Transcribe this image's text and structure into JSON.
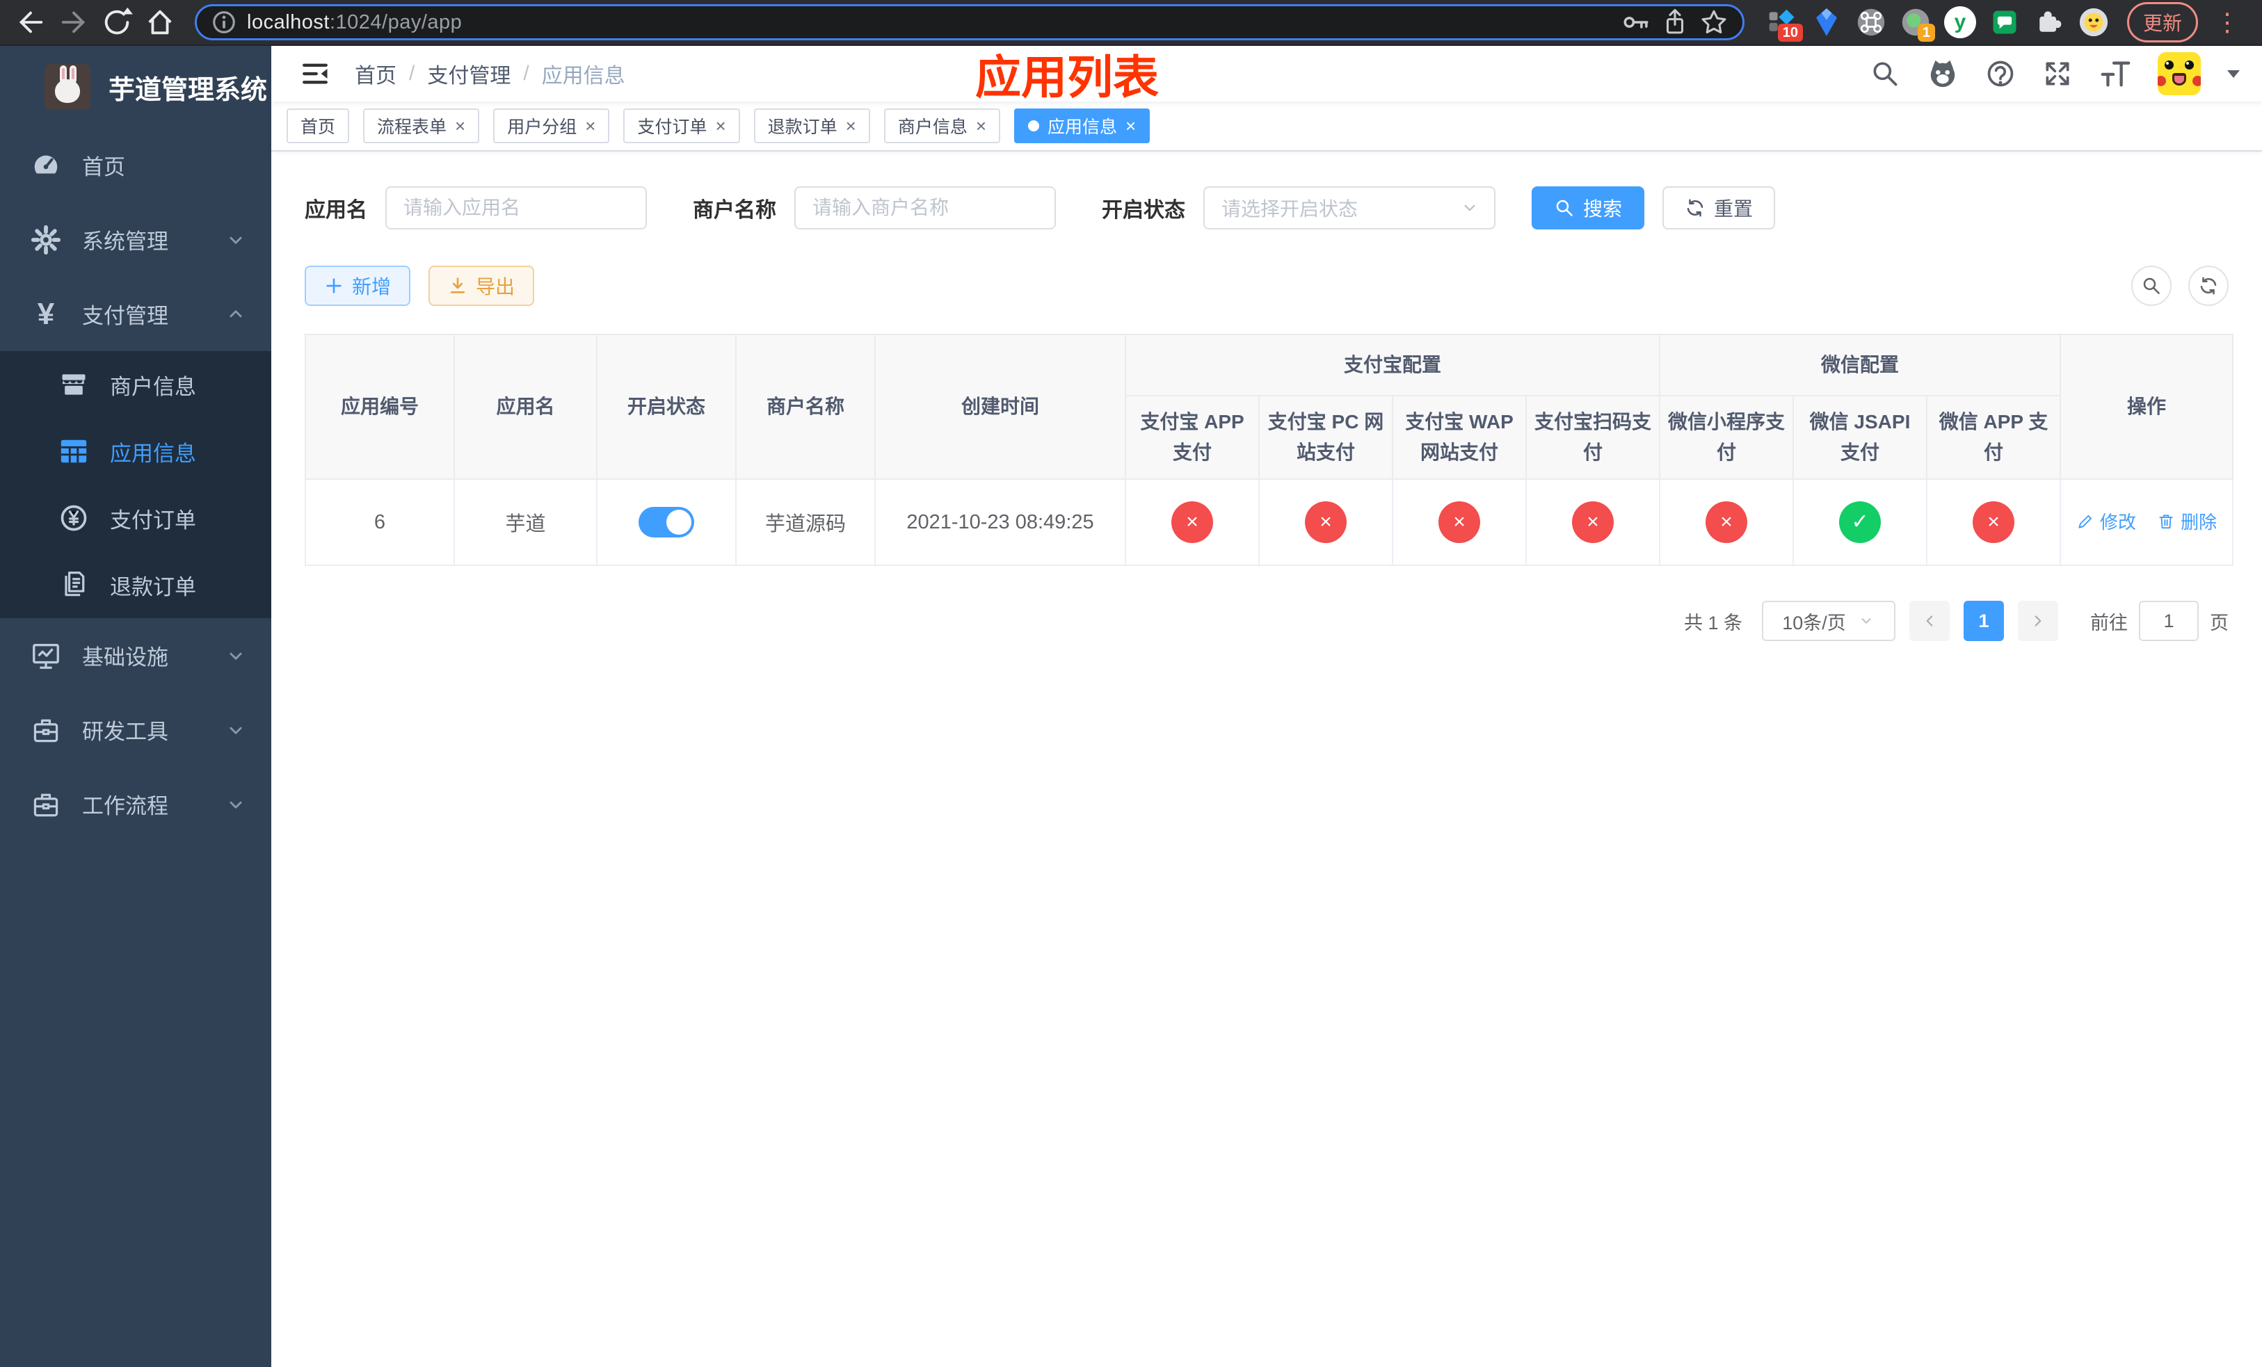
{
  "colors": {
    "primary": "#409eff",
    "danger": "#f34d4d",
    "success": "#13ce66",
    "warning": "#e6a23c",
    "annotation_red": "#ff3300",
    "sidebar_bg": "#304156",
    "submenu_bg": "#1f2d3d"
  },
  "browser": {
    "url_host": "localhost",
    "url_rest": ":1024/pay/app",
    "update_label": "更新",
    "ext_badge_pin": "10",
    "ext_badge_one": "1",
    "y_logo": "y"
  },
  "annotation": "应用列表",
  "sidebar": {
    "title": "芋道管理系统",
    "menu": [
      {
        "label": "首页"
      },
      {
        "label": "系统管理"
      },
      {
        "label": "支付管理"
      },
      {
        "label": "基础设施"
      },
      {
        "label": "研发工具"
      },
      {
        "label": "工作流程"
      }
    ],
    "submenu": [
      {
        "label": "商户信息"
      },
      {
        "label": "应用信息"
      },
      {
        "label": "支付订单"
      },
      {
        "label": "退款订单"
      }
    ],
    "yen_glyph": "¥"
  },
  "breadcrumb": {
    "items": [
      "首页",
      "支付管理",
      "应用信息"
    ],
    "separator": "/"
  },
  "tabs": [
    {
      "label": "首页"
    },
    {
      "label": "流程表单"
    },
    {
      "label": "用户分组"
    },
    {
      "label": "支付订单"
    },
    {
      "label": "退款订单"
    },
    {
      "label": "商户信息"
    },
    {
      "label": "应用信息"
    }
  ],
  "icons": {
    "close": "×"
  },
  "filters": {
    "app_name_label": "应用名",
    "app_name_placeholder": "请输入应用名",
    "merchant_label": "商户名称",
    "merchant_placeholder": "请输入商户名称",
    "status_label": "开启状态",
    "status_placeholder": "请选择开启状态",
    "search_label": "搜索",
    "reset_label": "重置"
  },
  "toolbar": {
    "add_label": "新增",
    "export_label": "导出"
  },
  "table": {
    "headers": {
      "app_id": "应用编号",
      "app_name": "应用名",
      "status": "开启状态",
      "merchant": "商户名称",
      "created": "创建时间",
      "alipay_group": "支付宝配置",
      "wechat_group": "微信配置",
      "channels": [
        "支付宝 APP 支付",
        "支付宝 PC 网站支付",
        "支付宝 WAP 网站支付",
        "支付宝扫码支付",
        "微信小程序支付",
        "微信 JSAPI 支付",
        "微信 APP 支付"
      ],
      "actions": "操作"
    },
    "row": {
      "app_id": "6",
      "app_name": "芋道",
      "toggle_cls": "switch on",
      "merchant": "芋道源码",
      "created": "2021-10-23 08:49:25",
      "channels": [
        {
          "glyph": "×",
          "cls": "status-dot red"
        },
        {
          "glyph": "×",
          "cls": "status-dot red"
        },
        {
          "glyph": "×",
          "cls": "status-dot red"
        },
        {
          "glyph": "×",
          "cls": "status-dot red"
        },
        {
          "glyph": "×",
          "cls": "status-dot red"
        },
        {
          "glyph": "✓",
          "cls": "status-dot green"
        },
        {
          "glyph": "×",
          "cls": "status-dot red"
        }
      ],
      "edit_label": "修改",
      "delete_label": "删除"
    }
  },
  "pagination": {
    "total": "共 1 条",
    "page_size": "10条/页",
    "page": "1",
    "goto_label": "前往",
    "goto_value": "1",
    "page_unit": "页"
  }
}
